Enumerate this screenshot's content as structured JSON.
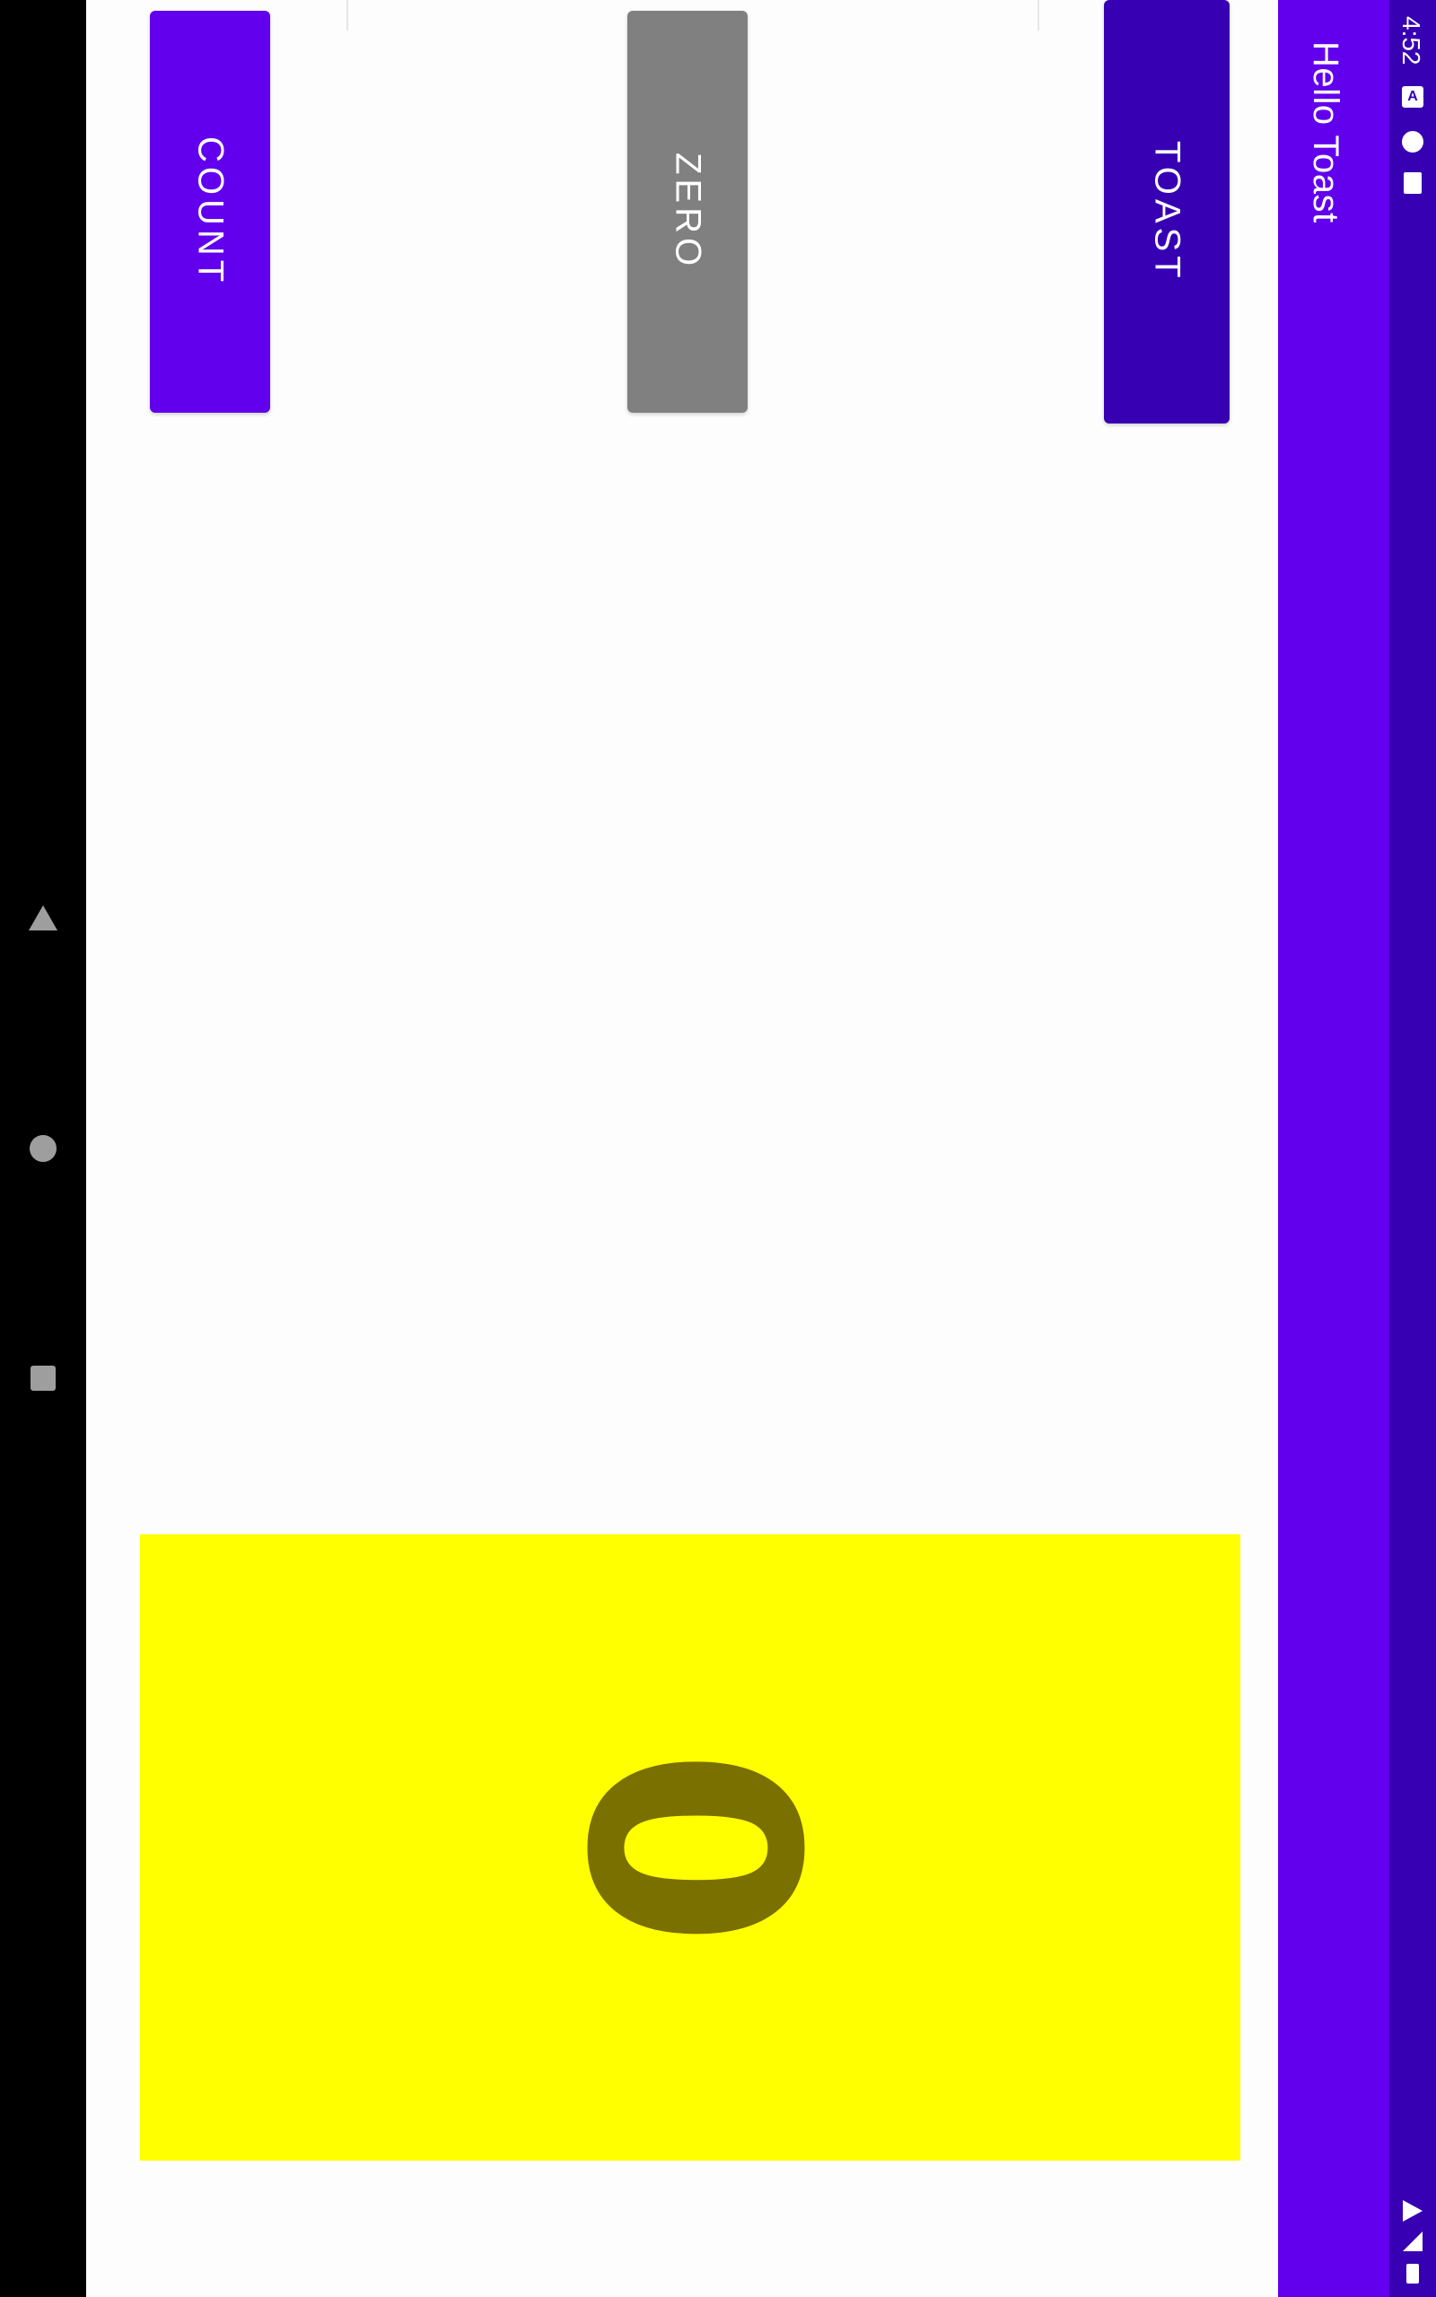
{
  "app_bar": {
    "title": "Hello Toast"
  },
  "status_bar": {
    "time": "4:52"
  },
  "buttons": {
    "toast": "TOAST",
    "zero": "ZERO",
    "count": "COUNT"
  },
  "counter": {
    "value": "0"
  },
  "colors": {
    "primary": "#6200ee",
    "primary_dark": "#3700b3",
    "zero_button": "#808080",
    "count_background": "#ffff00",
    "count_text": "#7a7000"
  },
  "icons": {
    "status_left": [
      "a-notification-icon",
      "circle-notification-icon",
      "sd-card-icon"
    ],
    "status_right": [
      "wifi-icon",
      "signal-icon",
      "battery-icon"
    ],
    "navigation": [
      "back-icon",
      "home-icon",
      "recents-icon"
    ]
  }
}
